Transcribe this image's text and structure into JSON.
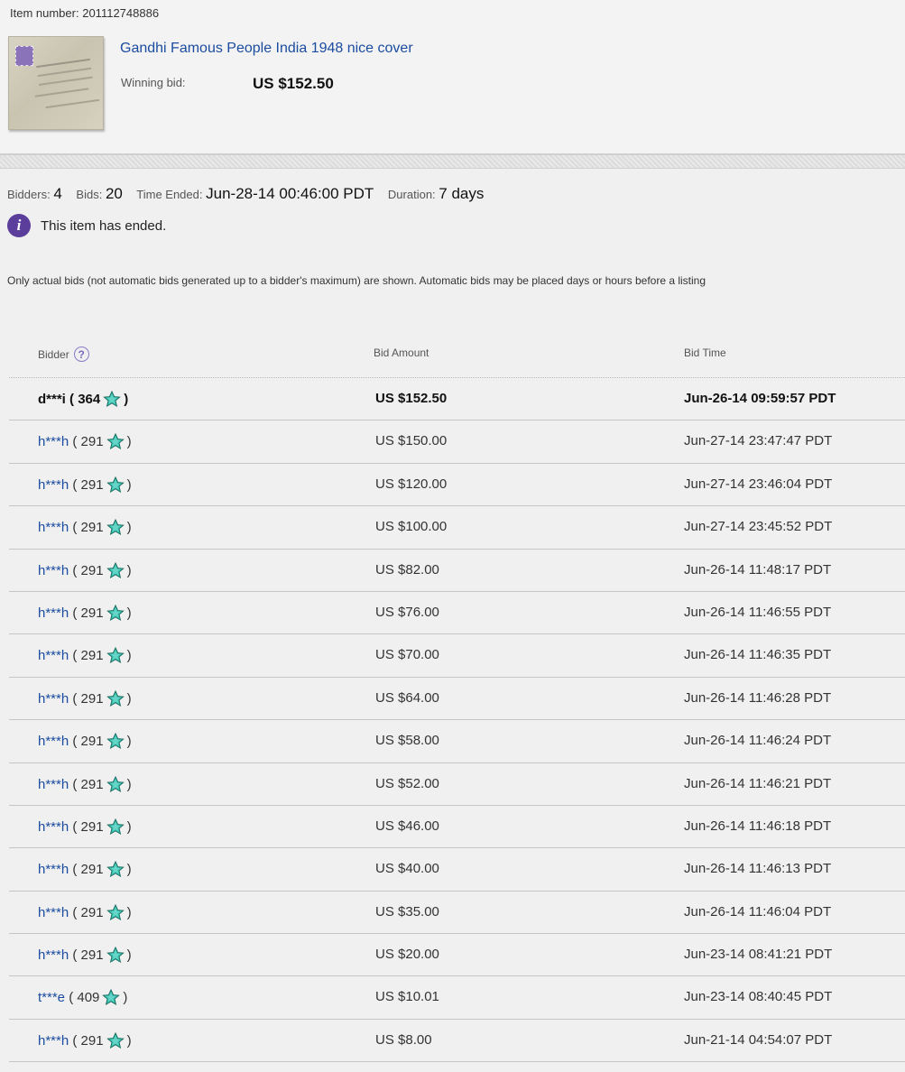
{
  "item": {
    "number_label": "Item number:",
    "number": "201112748886",
    "title": "Gandhi Famous People India 1948 nice cover",
    "winning_label": "Winning bid:",
    "winning_value": "US $152.50"
  },
  "stats": {
    "bidders_label": "Bidders:",
    "bidders": "4",
    "bids_label": "Bids:",
    "bids": "20",
    "time_ended_label": "Time Ended:",
    "time_ended": "Jun-28-14 00:46:00 PDT",
    "duration_label": "Duration:",
    "duration": "7 days"
  },
  "status": {
    "ended_text": "This item has ended."
  },
  "notice": "Only actual bids (not automatic bids generated up to a bidder's maximum) are shown. Automatic bids may be placed days or hours before a listing",
  "table": {
    "headers": [
      "Bidder",
      "Bid Amount",
      "Bid Time"
    ],
    "rows": [
      {
        "bidder": "d***i",
        "score": "364",
        "amount": "US $152.50",
        "time": "Jun-26-14 09:59:57 PDT",
        "winner": true
      },
      {
        "bidder": "h***h",
        "score": "291",
        "amount": "US $150.00",
        "time": "Jun-27-14 23:47:47 PDT"
      },
      {
        "bidder": "h***h",
        "score": "291",
        "amount": "US $120.00",
        "time": "Jun-27-14 23:46:04 PDT"
      },
      {
        "bidder": "h***h",
        "score": "291",
        "amount": "US $100.00",
        "time": "Jun-27-14 23:45:52 PDT"
      },
      {
        "bidder": "h***h",
        "score": "291",
        "amount": "US $82.00",
        "time": "Jun-26-14 11:48:17 PDT"
      },
      {
        "bidder": "h***h",
        "score": "291",
        "amount": "US $76.00",
        "time": "Jun-26-14 11:46:55 PDT"
      },
      {
        "bidder": "h***h",
        "score": "291",
        "amount": "US $70.00",
        "time": "Jun-26-14 11:46:35 PDT"
      },
      {
        "bidder": "h***h",
        "score": "291",
        "amount": "US $64.00",
        "time": "Jun-26-14 11:46:28 PDT"
      },
      {
        "bidder": "h***h",
        "score": "291",
        "amount": "US $58.00",
        "time": "Jun-26-14 11:46:24 PDT"
      },
      {
        "bidder": "h***h",
        "score": "291",
        "amount": "US $52.00",
        "time": "Jun-26-14 11:46:21 PDT"
      },
      {
        "bidder": "h***h",
        "score": "291",
        "amount": "US $46.00",
        "time": "Jun-26-14 11:46:18 PDT"
      },
      {
        "bidder": "h***h",
        "score": "291",
        "amount": "US $40.00",
        "time": "Jun-26-14 11:46:13 PDT"
      },
      {
        "bidder": "h***h",
        "score": "291",
        "amount": "US $35.00",
        "time": "Jun-26-14 11:46:04 PDT"
      },
      {
        "bidder": "h***h",
        "score": "291",
        "amount": "US $20.00",
        "time": "Jun-23-14 08:41:21 PDT"
      },
      {
        "bidder": "t***e",
        "score": "409",
        "amount": "US $10.01",
        "time": "Jun-23-14 08:40:45 PDT"
      },
      {
        "bidder": "h***h",
        "score": "291",
        "amount": "US $8.00",
        "time": "Jun-21-14 04:54:07 PDT"
      }
    ]
  },
  "icons": {
    "info": "info-icon",
    "help": "help-icon",
    "feedback_star": "turquoise-star-icon"
  },
  "colors": {
    "link": "#1b4ca0",
    "info": "#5b3d9c",
    "star": "#3cc7b6"
  }
}
